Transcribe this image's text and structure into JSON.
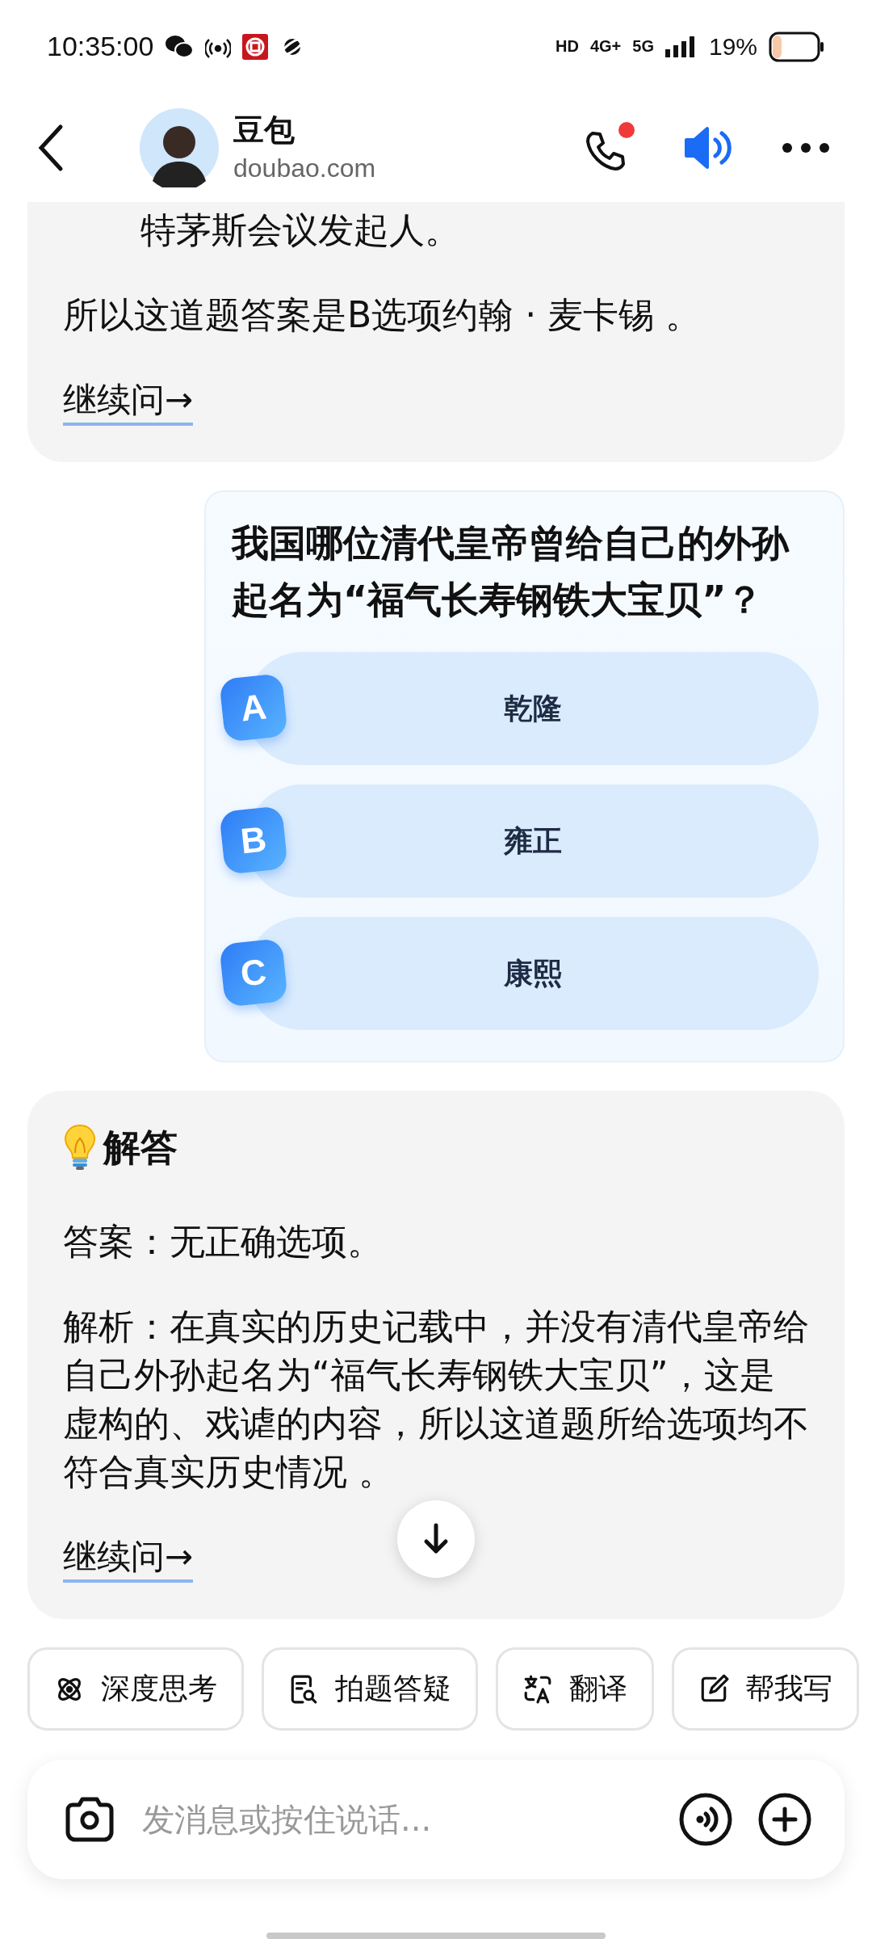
{
  "status_bar": {
    "time": "10:35:00",
    "network": [
      "HD",
      "4G+",
      "5G"
    ],
    "battery": "19%"
  },
  "header": {
    "name": "豆包",
    "subtitle": "doubao.com",
    "call_badge": true
  },
  "messages": [
    {
      "kind": "reply",
      "paragraphs": [
        {
          "text": "特茅斯会议发起人。",
          "indented": true
        },
        {
          "text": "所以这道题答案是B选项约翰 · 麦卡锡 。",
          "indented": false
        }
      ],
      "link": "继续问→"
    },
    {
      "kind": "quiz",
      "question": "我国哪位清代皇帝曾给自己的外孙起名为“福气长寿钢铁大宝贝”？",
      "options": [
        {
          "letter": "A",
          "text": "乾隆"
        },
        {
          "letter": "B",
          "text": "雍正"
        },
        {
          "letter": "C",
          "text": "康熙"
        }
      ]
    },
    {
      "kind": "reply",
      "heading": "解答",
      "paragraphs": [
        {
          "text": "答案：无正确选项。",
          "indented": false
        },
        {
          "text": "解析：在真实的历史记载中，并没有清代皇帝给自己外孙起名为“福气长寿钢铁大宝贝”，这是虚构的、戏谑的内容，所以这道题所给选项均不符合真实历史情况 。",
          "indented": false
        }
      ],
      "link": "继续问→"
    }
  ],
  "quick_actions": [
    {
      "kind": "atom",
      "label": "深度思考"
    },
    {
      "kind": "doc-search",
      "label": "拍题答疑"
    },
    {
      "kind": "translate",
      "label": "翻译"
    },
    {
      "kind": "edit",
      "label": "帮我写"
    }
  ],
  "input": {
    "placeholder": "发消息或按住说话..."
  }
}
